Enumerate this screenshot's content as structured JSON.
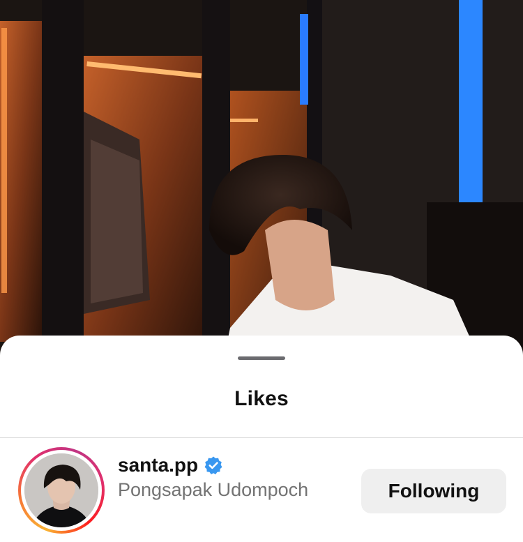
{
  "background": {
    "description_icon": "photo-icon"
  },
  "sheet": {
    "title": "Likes"
  },
  "likes": [
    {
      "username": "santa.pp",
      "verified": true,
      "full_name": "Pongsapak Udompoch",
      "button_label": "Following"
    }
  ],
  "colors": {
    "verified_blue": "#3897f0",
    "button_bg": "#efefef",
    "secondary_text": "#737373"
  }
}
